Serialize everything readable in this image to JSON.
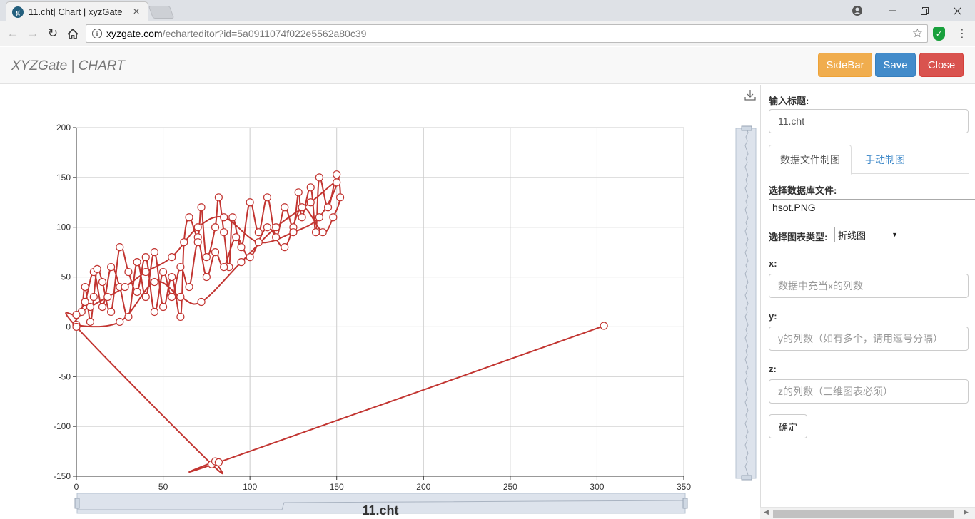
{
  "browser": {
    "tab_title": "11.cht| Chart | xyzGate",
    "tab_favicon": "g",
    "url_host": "xyzgate.com",
    "url_path": "/echarteditor?id=5a0911074f022e5562a80c39"
  },
  "header": {
    "brand": "XYZGate | CHART",
    "sidebar_label": "SideBar",
    "save_label": "Save",
    "close_label": "Close"
  },
  "panel": {
    "title_label": "输入标题:",
    "title_value": "11.cht",
    "tabs": [
      "数据文件制图",
      "手动制图"
    ],
    "db_file_label": "选择数据库文件:",
    "db_file_value": "hsot.PNG",
    "chart_type_label": "选择图表类型:",
    "chart_type_value": "折线图",
    "x_label": "x:",
    "x_placeholder": "数据中充当x的列数",
    "y_label": "y:",
    "y_placeholder": "y的列数（如有多个，请用逗号分隔）",
    "z_label": "z:",
    "z_placeholder": "z的列数（三维图表必须）",
    "confirm_label": "确定"
  },
  "colors": {
    "series": "#c23531",
    "sidebar_btn": "#f0ad4e",
    "save_btn": "#428bca",
    "close_btn": "#d9534f"
  },
  "chart_data": {
    "type": "line",
    "title": "11.cht",
    "xlabel": "",
    "ylabel": "",
    "xlim": [
      0,
      350
    ],
    "ylim": [
      -150,
      200
    ],
    "x_ticks": [
      0,
      50,
      100,
      150,
      200,
      250,
      300,
      350
    ],
    "y_ticks": [
      -150,
      -100,
      -50,
      0,
      50,
      100,
      150,
      200
    ],
    "grid": true,
    "smooth": true,
    "series": [
      {
        "color": "#c23531",
        "points": [
          [
            0,
            12
          ],
          [
            5,
            25
          ],
          [
            10,
            55
          ],
          [
            15,
            20
          ],
          [
            20,
            60
          ],
          [
            25,
            40
          ],
          [
            30,
            10
          ],
          [
            35,
            65
          ],
          [
            40,
            30
          ],
          [
            45,
            75
          ],
          [
            50,
            20
          ],
          [
            55,
            50
          ],
          [
            60,
            10
          ],
          [
            62,
            85
          ],
          [
            65,
            110
          ],
          [
            70,
            90
          ],
          [
            72,
            120
          ],
          [
            75,
            70
          ],
          [
            80,
            100
          ],
          [
            82,
            130
          ],
          [
            85,
            95
          ],
          [
            88,
            60
          ],
          [
            90,
            110
          ],
          [
            95,
            80
          ],
          [
            100,
            125
          ],
          [
            105,
            95
          ],
          [
            110,
            130
          ],
          [
            115,
            90
          ],
          [
            120,
            120
          ],
          [
            125,
            100
          ],
          [
            128,
            135
          ],
          [
            130,
            110
          ],
          [
            135,
            140
          ],
          [
            138,
            95
          ],
          [
            140,
            150
          ],
          [
            145,
            120
          ],
          [
            150,
            153
          ],
          [
            152,
            130
          ],
          [
            148,
            110
          ],
          [
            142,
            95
          ],
          [
            130,
            120
          ],
          [
            120,
            80
          ],
          [
            110,
            100
          ],
          [
            100,
            70
          ],
          [
            92,
            90
          ],
          [
            85,
            60
          ],
          [
            80,
            75
          ],
          [
            75,
            50
          ],
          [
            70,
            85
          ],
          [
            65,
            40
          ],
          [
            60,
            60
          ],
          [
            55,
            30
          ],
          [
            50,
            55
          ],
          [
            45,
            15
          ],
          [
            40,
            70
          ],
          [
            35,
            35
          ],
          [
            30,
            55
          ],
          [
            25,
            80
          ],
          [
            20,
            15
          ],
          [
            15,
            45
          ],
          [
            12,
            58
          ],
          [
            10,
            30
          ],
          [
            8,
            5
          ],
          [
            5,
            40
          ],
          [
            3,
            15
          ],
          [
            0,
            2
          ],
          [
            25,
            5
          ],
          [
            45,
            45
          ],
          [
            60,
            30
          ],
          [
            72,
            25
          ],
          [
            95,
            65
          ],
          [
            115,
            100
          ],
          [
            135,
            125
          ],
          [
            150,
            145
          ],
          [
            140,
            110
          ],
          [
            125,
            95
          ],
          [
            105,
            85
          ],
          [
            85,
            110
          ],
          [
            70,
            100
          ],
          [
            55,
            70
          ],
          [
            40,
            55
          ],
          [
            28,
            40
          ],
          [
            18,
            30
          ],
          [
            8,
            20
          ],
          [
            0,
            12
          ],
          [
            0,
            0
          ],
          [
            78,
            -138
          ],
          [
            80,
            -135
          ],
          [
            82,
            -136
          ],
          [
            304,
            1
          ]
        ]
      }
    ],
    "vertical_zoom_slider": true,
    "horizontal_zoom_slider": true
  }
}
